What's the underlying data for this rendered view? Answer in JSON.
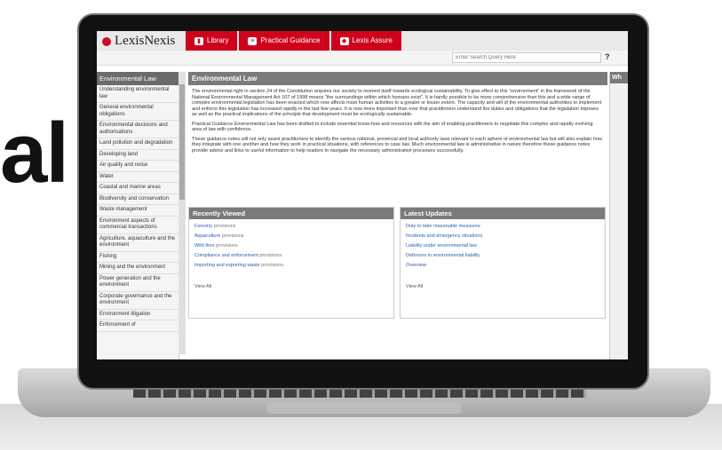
{
  "background_text": "al",
  "app": {
    "logo": "LexisNexis",
    "tabs": [
      {
        "label": "Library",
        "icon": "book-icon"
      },
      {
        "label": "Practical Guidance",
        "icon": "document-icon"
      },
      {
        "label": "Lexis Assure",
        "icon": "shield-icon"
      }
    ],
    "search_placeholder": "Enter Search Query Here",
    "help": "?"
  },
  "sidebar": {
    "heading": "Environmental Law",
    "items": [
      "Understanding environmental law",
      "General environmental obligations",
      "Environmental decisions and authorisations",
      "Land pollution and degradation",
      "Developing land",
      "Air quality and noise",
      "Water",
      "Coastal and marine areas",
      "Biodiversity and conservation",
      "Waste management",
      "Environment aspects of commercial transactions",
      "Agriculture, aquaculture and the environment",
      "Fishing",
      "Mining and the environment",
      "Power generation and the environment",
      "Corporate governance and the environment",
      "Environment litigation",
      "Enforcement of"
    ]
  },
  "main": {
    "title": "Environmental Law",
    "paragraphs": [
      "The environmental right in section 24 of the Constitution requires our society to reorient itself towards ecological sustainability. To give effect to this \"environment\" in the framework of the National Environmental Management Act 107 of 1998 means \"the surroundings within which humans exist\". It is hardly possible to be more comprehensive than this and a wide range of complex environmental legislation has been enacted which now affects most human activities to a greater or lesser extent. The capacity and will of the environmental authorities to implement and enforce this legislation has increased rapidly in the last few years. It is now more important than ever that practitioners understand the duties and obligations that the legislation imposes as well as the practical implications of the principle that development must be ecologically sustainable.",
      "Practical Guidance Environmental Law has been drafted to include essential know-how and resources with the aim of enabling practitioners to negotiate this complex and rapidly evolving area of law with confidence.",
      "These guidance notes will not only assist practitioners to identify the various national, provincial and local authority laws relevant to each sphere of environmental law but will also explain how they integrate with one another and how they work in practical situations, with references to case law. Much environmental law is administrative in nature therefore these guidance notes provide advice and links to useful information to help readers to navigate the necessary administrative processes successfully."
    ]
  },
  "recently_viewed": {
    "title": "Recently Viewed",
    "items": [
      {
        "label": "Forestry",
        "type": "provisions"
      },
      {
        "label": "Aquaculture",
        "type": "provisions"
      },
      {
        "label": "Wild fires",
        "type": "provisions"
      },
      {
        "label": "Compliance and enforcement",
        "type": "provisions"
      },
      {
        "label": "Importing and exporting waste",
        "type": "provisions"
      }
    ],
    "view_all": "View All"
  },
  "latest_updates": {
    "title": "Latest Updates",
    "items": [
      "Duty to take reasonable measures",
      "Incidents and emergency situations",
      "Liability under environmental law",
      "Defences to environmental liability",
      "Overview"
    ],
    "view_all": "View All"
  },
  "right_panel": {
    "heading": "Wh"
  }
}
